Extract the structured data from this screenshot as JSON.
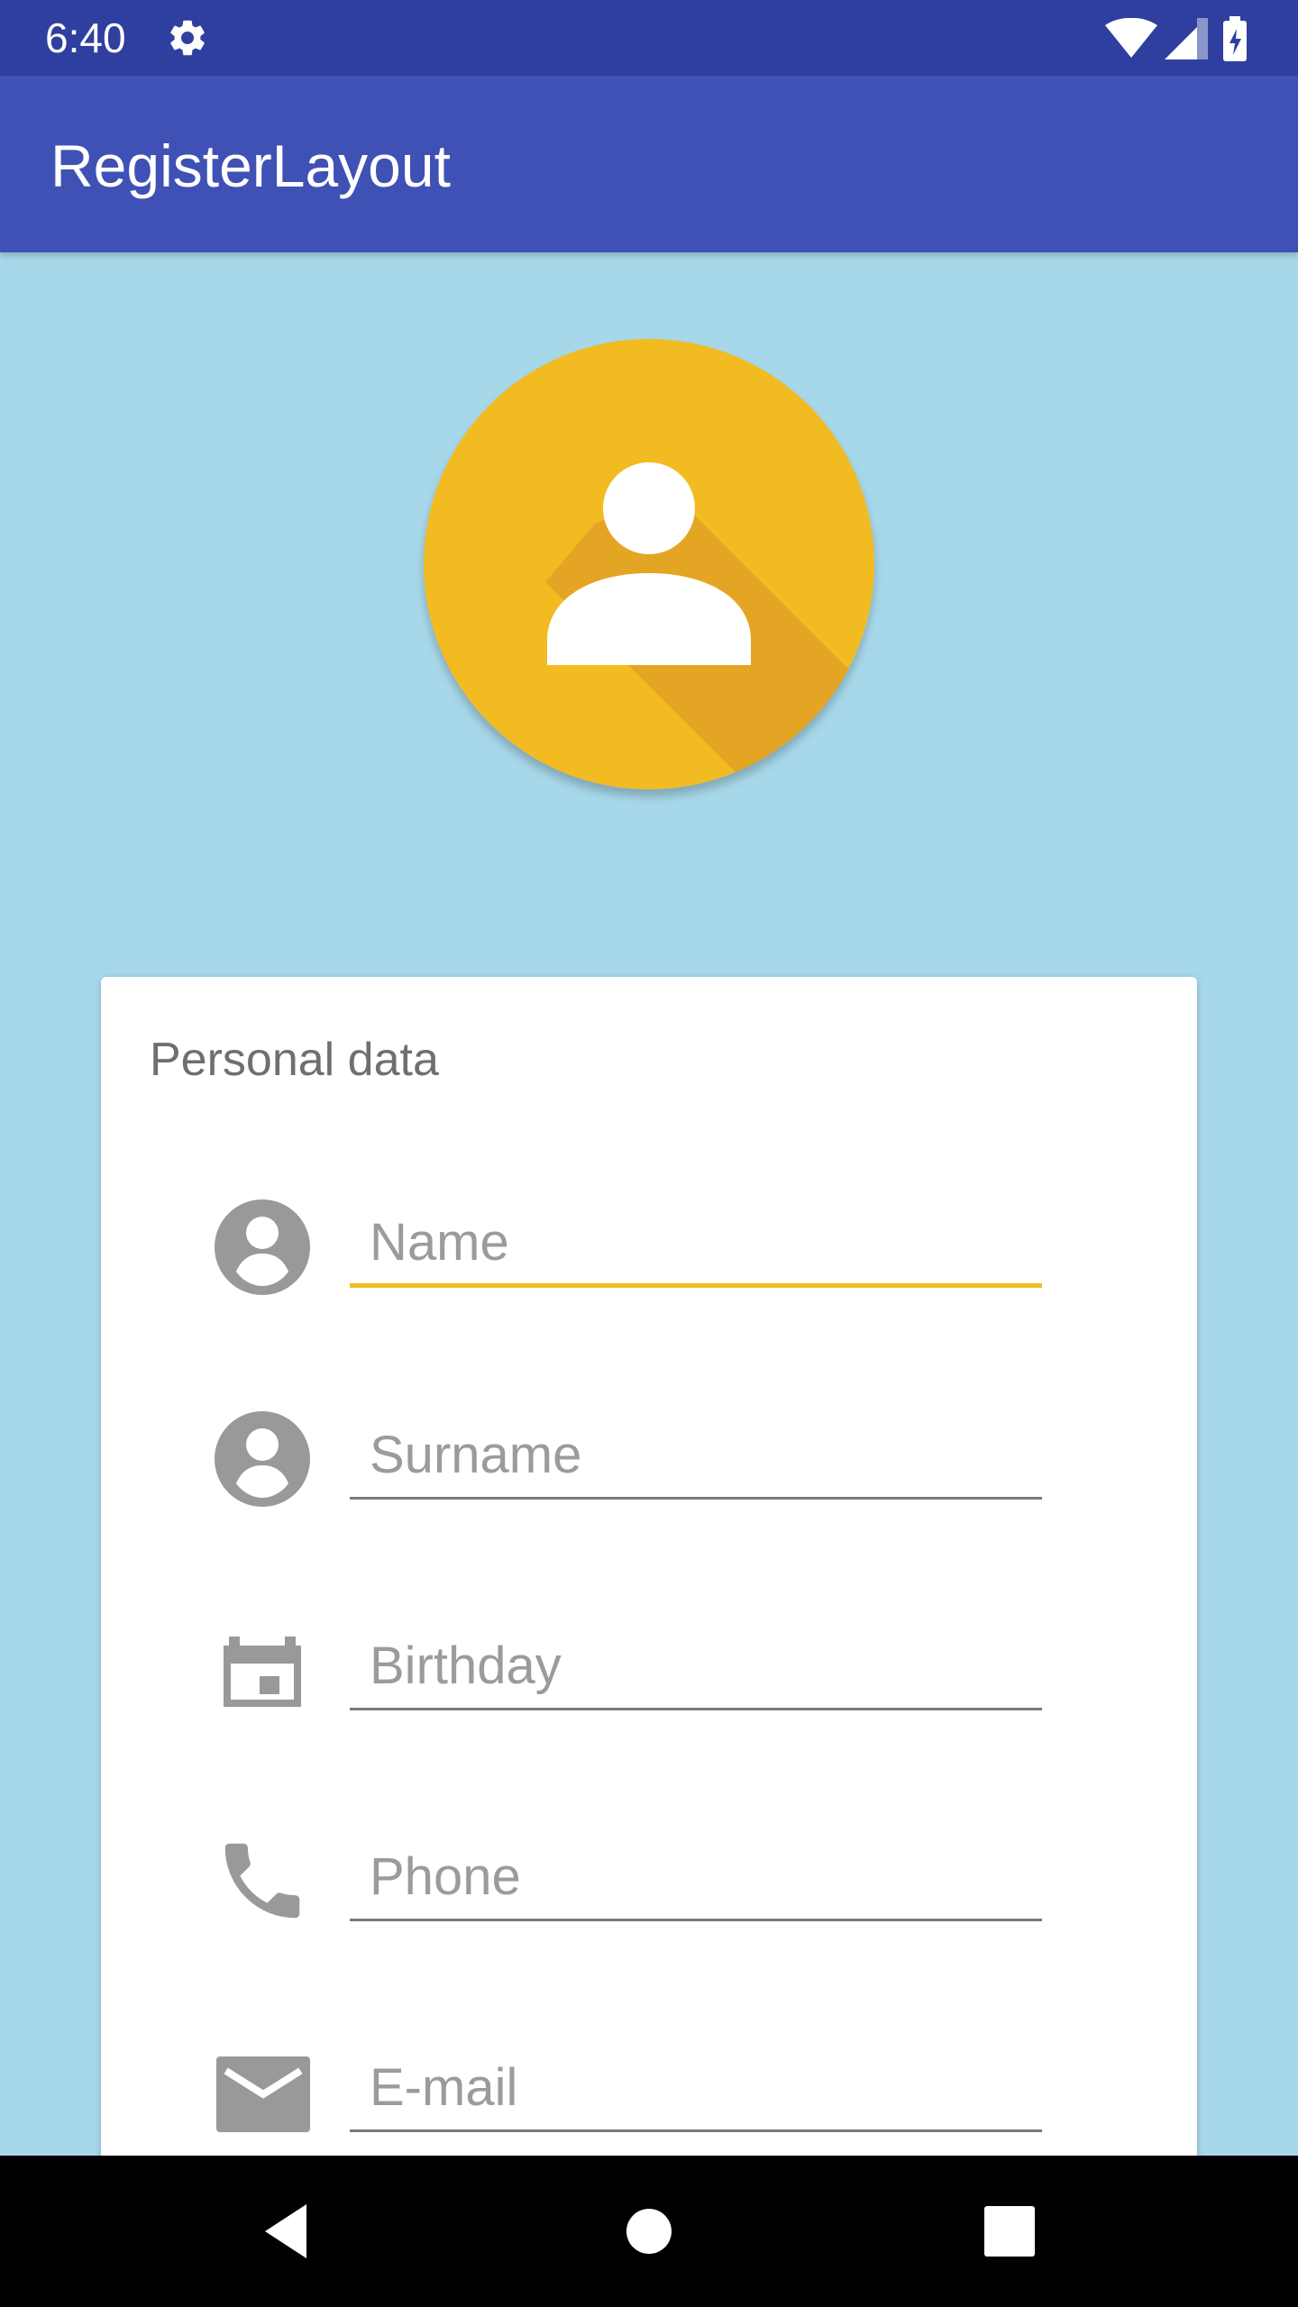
{
  "status_bar": {
    "time": "6:40",
    "icons": [
      "settings-icon",
      "wifi-icon",
      "signal-icon",
      "battery-charging-icon"
    ]
  },
  "app_bar": {
    "title": "RegisterLayout"
  },
  "avatar": {
    "icon": "person-avatar-icon",
    "colors": {
      "background": "#f2bb22",
      "shadow": "#e5a524",
      "person": "#ffffff"
    }
  },
  "form": {
    "section_title": "Personal data",
    "fields": [
      {
        "icon": "account-circle-icon",
        "placeholder": "Name",
        "value": "",
        "active": true
      },
      {
        "icon": "account-circle-icon",
        "placeholder": "Surname",
        "value": "",
        "active": false
      },
      {
        "icon": "calendar-icon",
        "placeholder": "Birthday",
        "value": "",
        "active": false
      },
      {
        "icon": "phone-icon",
        "placeholder": "Phone",
        "value": "",
        "active": false
      },
      {
        "icon": "mail-icon",
        "placeholder": "E-mail",
        "value": "",
        "active": false
      }
    ]
  },
  "navigation": {
    "buttons": [
      "back-icon",
      "home-icon",
      "recent-apps-icon"
    ]
  },
  "colors": {
    "status_bar": "#2f3f9f",
    "app_bar": "#3f51b5",
    "background": "#a7d8ea",
    "card": "#ffffff",
    "accent": "#f2bb22",
    "icon_gray": "#999999",
    "text_gray": "#6f6f6f",
    "nav_bar": "#000000"
  }
}
